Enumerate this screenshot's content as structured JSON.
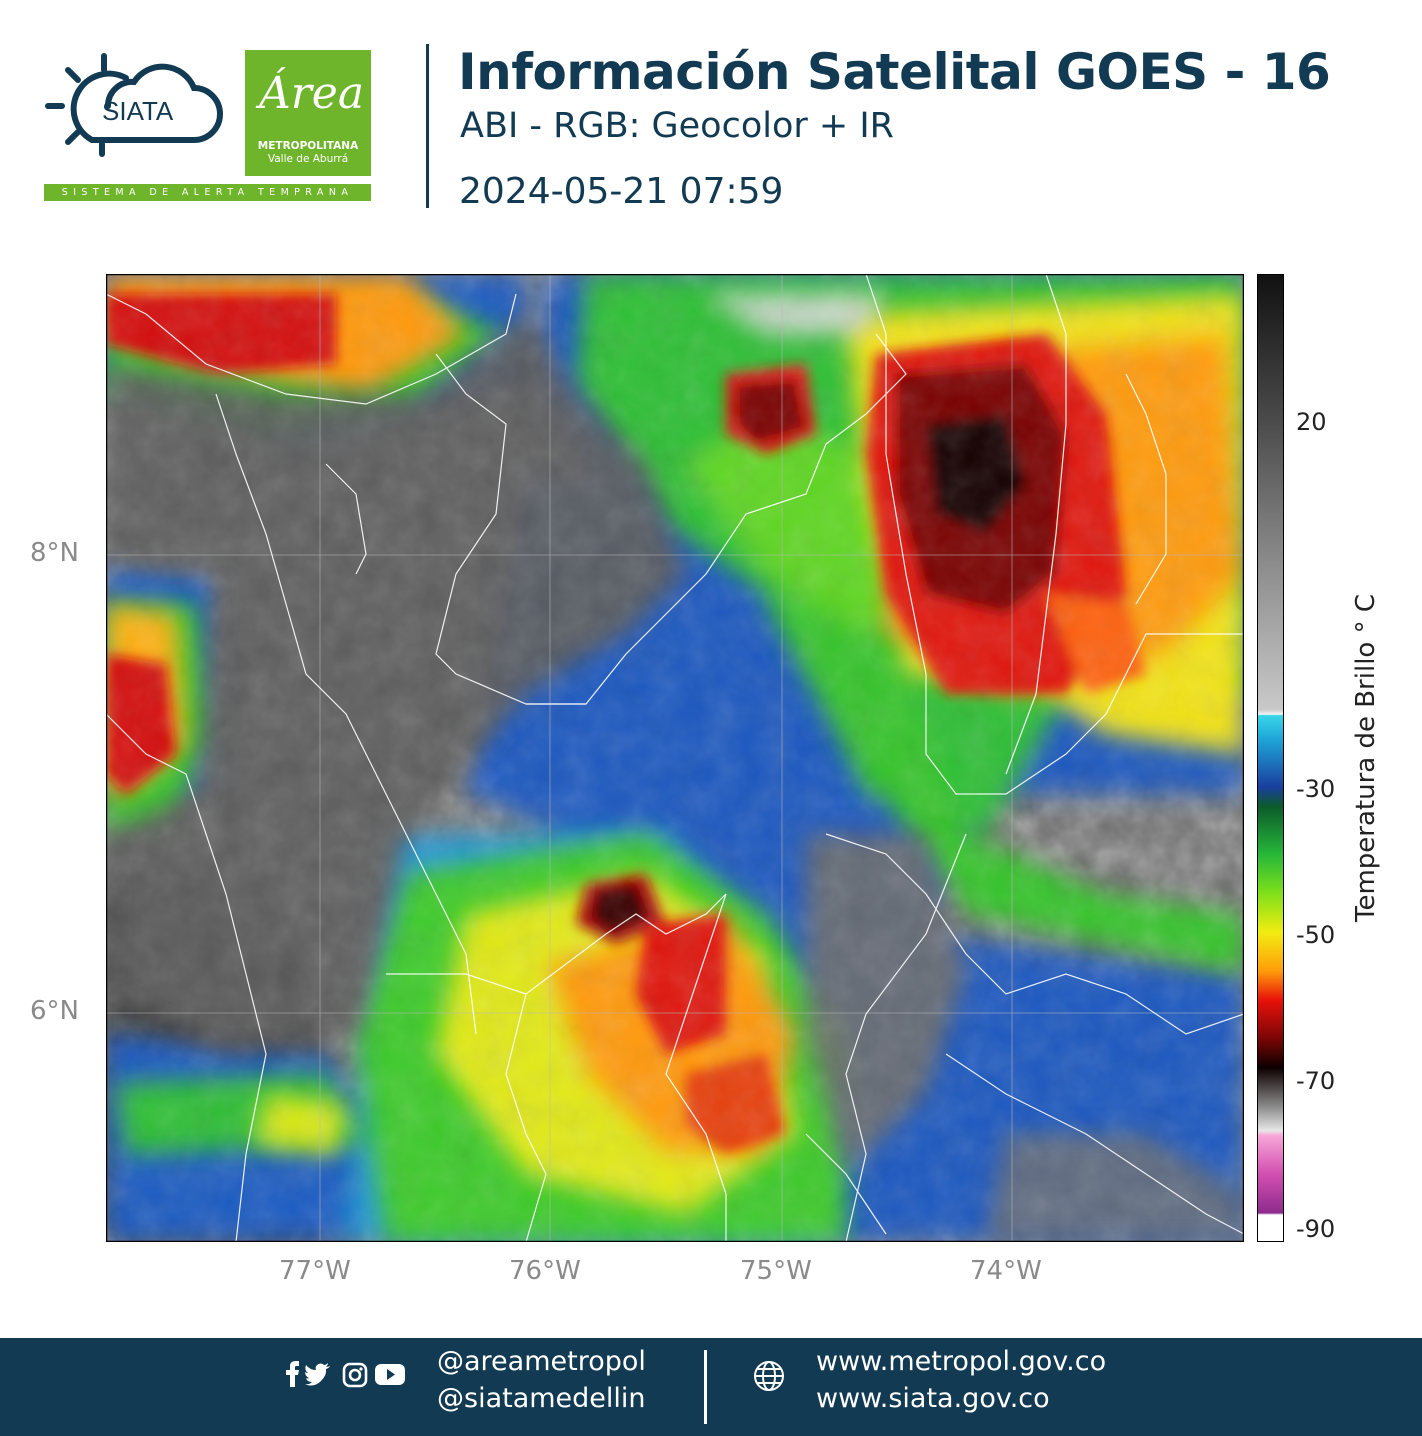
{
  "header": {
    "title": "Información Satelital GOES - 16",
    "subtitle": "ABI - RGB: Geocolor + IR",
    "datetime": "2024-05-21 07:59"
  },
  "logos": {
    "siata_text": "SIATA",
    "siata_strip": "SISTEMA DE ALERTA TEMPRANA",
    "area_script": "Área",
    "area_line1": "METROPOLITANA",
    "area_line2": "Valle de Aburrá",
    "brand_green": "#6fb52b",
    "brand_navy": "#123a52"
  },
  "map": {
    "lat_labels": [
      "8°N",
      "6°N"
    ],
    "lon_labels": [
      "77°W",
      "76°W",
      "75°W",
      "74°W"
    ],
    "colorbar": {
      "title": "Temperatura de Brillo ° C",
      "ticks": [
        "20",
        "-30",
        "-50",
        "-70",
        "-90"
      ],
      "stops": [
        {
          "t": 0.0,
          "c": "#111111"
        },
        {
          "t": 0.15,
          "c": "#4a4a4a"
        },
        {
          "t": 0.3,
          "c": "#8c8c8c"
        },
        {
          "t": 0.45,
          "c": "#c9c9c9"
        },
        {
          "t": 0.455,
          "c": "#f4f4f4"
        },
        {
          "t": 0.454,
          "c": "#f4f4f4"
        },
        {
          "t": 0.456,
          "c": "#38d6e8"
        },
        {
          "t": 0.48,
          "c": "#1fa6d8"
        },
        {
          "t": 0.53,
          "c": "#1a3f9e"
        },
        {
          "t": 0.55,
          "c": "#0c5b2a"
        },
        {
          "t": 0.6,
          "c": "#27b83a"
        },
        {
          "t": 0.64,
          "c": "#7fe01a"
        },
        {
          "t": 0.68,
          "c": "#f2ec12"
        },
        {
          "t": 0.72,
          "c": "#ff9d0a"
        },
        {
          "t": 0.75,
          "c": "#e8120b"
        },
        {
          "t": 0.79,
          "c": "#7a0505"
        },
        {
          "t": 0.82,
          "c": "#0d0000"
        },
        {
          "t": 0.86,
          "c": "#8a8a8a"
        },
        {
          "t": 0.885,
          "c": "#e7e7e7"
        },
        {
          "t": 0.89,
          "c": "#f7a6d9"
        },
        {
          "t": 0.93,
          "c": "#d24fb0"
        },
        {
          "t": 0.97,
          "c": "#8e2b8e"
        },
        {
          "t": 0.972,
          "c": "#ffffff"
        },
        {
          "t": 1.0,
          "c": "#ffffff"
        }
      ]
    }
  },
  "footer": {
    "handle1": "@areametropol",
    "handle2": "@siatamedellin",
    "url1": "www.metropol.gov.co",
    "url2": "www.siata.gov.co"
  }
}
